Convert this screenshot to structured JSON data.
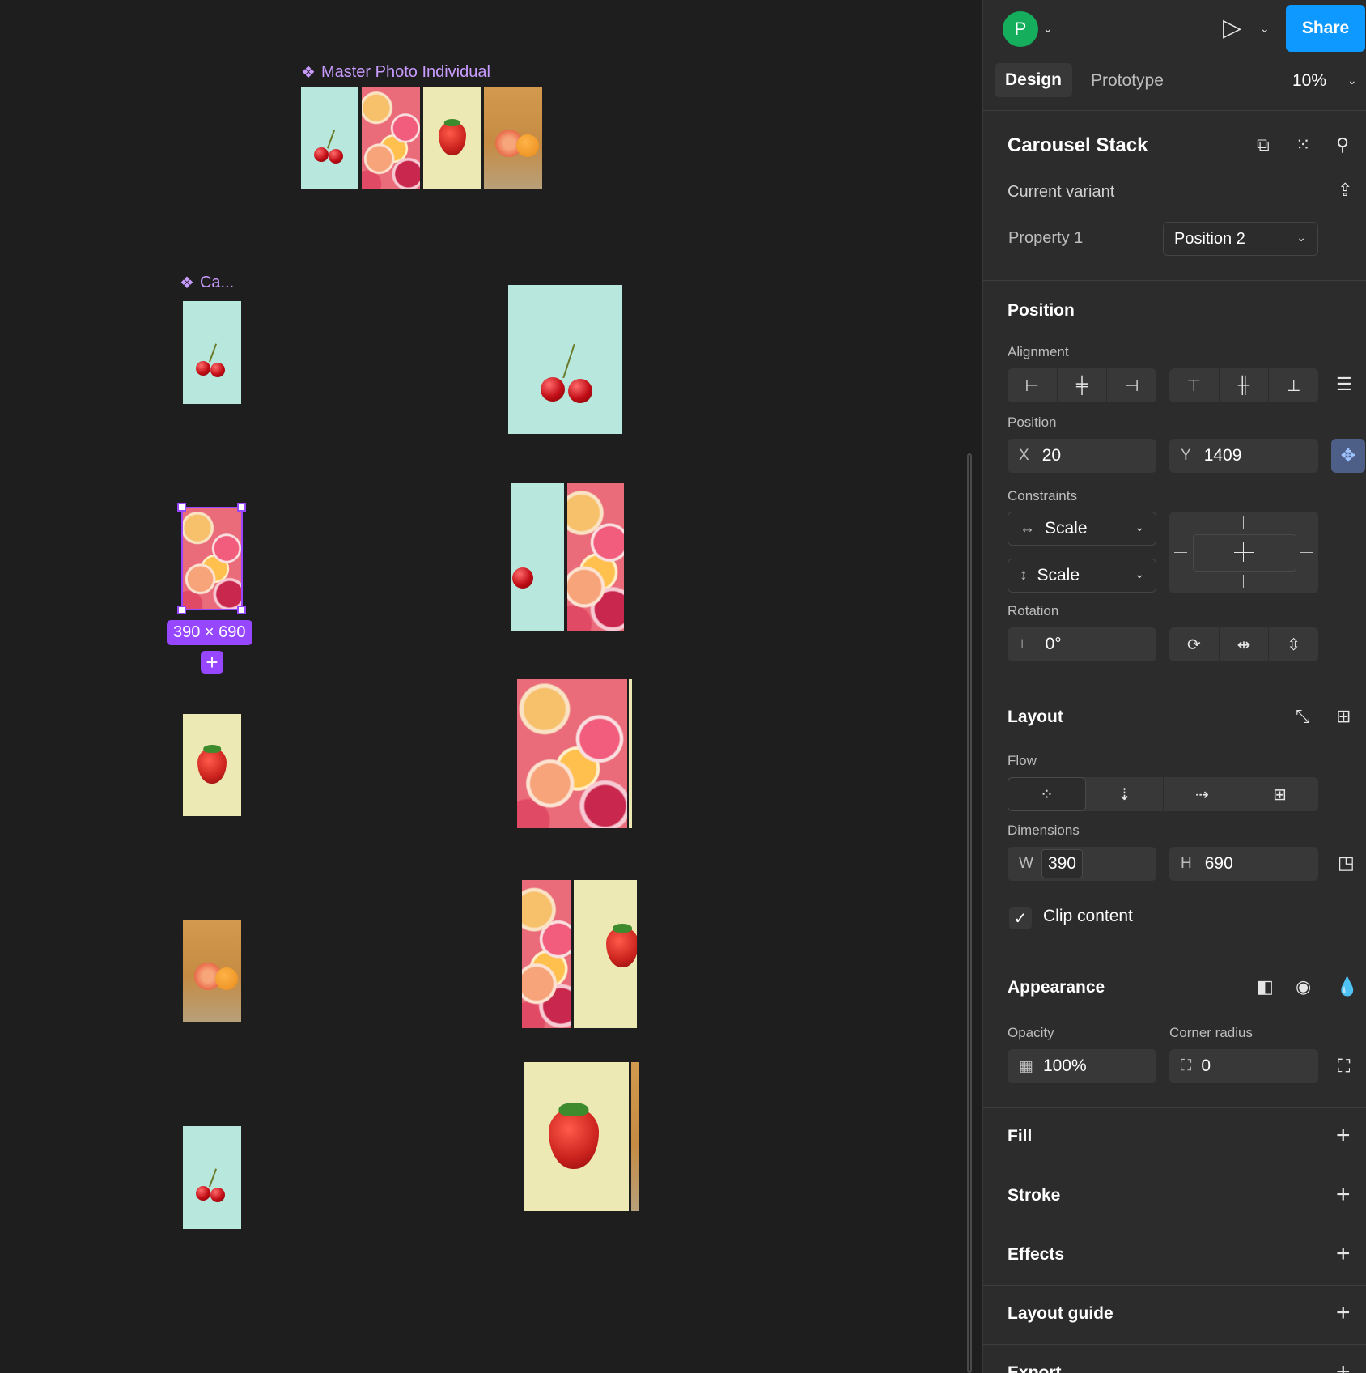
{
  "canvas": {
    "master_label": "Master Photo Individual",
    "component_label": "Ca...",
    "selection_size": "390 × 690",
    "selection_plus": "+"
  },
  "topbar": {
    "avatar_letter": "P",
    "avatar_color": "#14ae5c",
    "share_label": "Share",
    "share_color": "#0d99ff"
  },
  "tabs": {
    "design": "Design",
    "prototype": "Prototype",
    "zoom": "10%"
  },
  "component": {
    "name": "Carousel Stack",
    "current_variant": "Current variant",
    "property_label": "Property 1",
    "property_value": "Position 2"
  },
  "position": {
    "title": "Position",
    "alignment_label": "Alignment",
    "position_label": "Position",
    "x_prefix": "X",
    "x_value": "20",
    "y_prefix": "Y",
    "y_value": "1409",
    "constraints_label": "Constraints",
    "constraint_h": "Scale",
    "constraint_v": "Scale",
    "rotation_label": "Rotation",
    "rotation_value": "0°"
  },
  "layout": {
    "title": "Layout",
    "flow_label": "Flow",
    "dimensions_label": "Dimensions",
    "w_prefix": "W",
    "w_value": "390",
    "h_prefix": "H",
    "h_value": "690",
    "clip_label": "Clip content",
    "clip_checked": true
  },
  "appearance": {
    "title": "Appearance",
    "opacity_label": "Opacity",
    "opacity_value": "100%",
    "radius_label": "Corner radius",
    "radius_value": "0"
  },
  "sections": {
    "fill": "Fill",
    "stroke": "Stroke",
    "effects": "Effects",
    "layout_guide": "Layout guide",
    "export": "Export"
  },
  "icons": {
    "plus": "+",
    "chevron": "⌄",
    "play": "▷",
    "check": "✓"
  }
}
